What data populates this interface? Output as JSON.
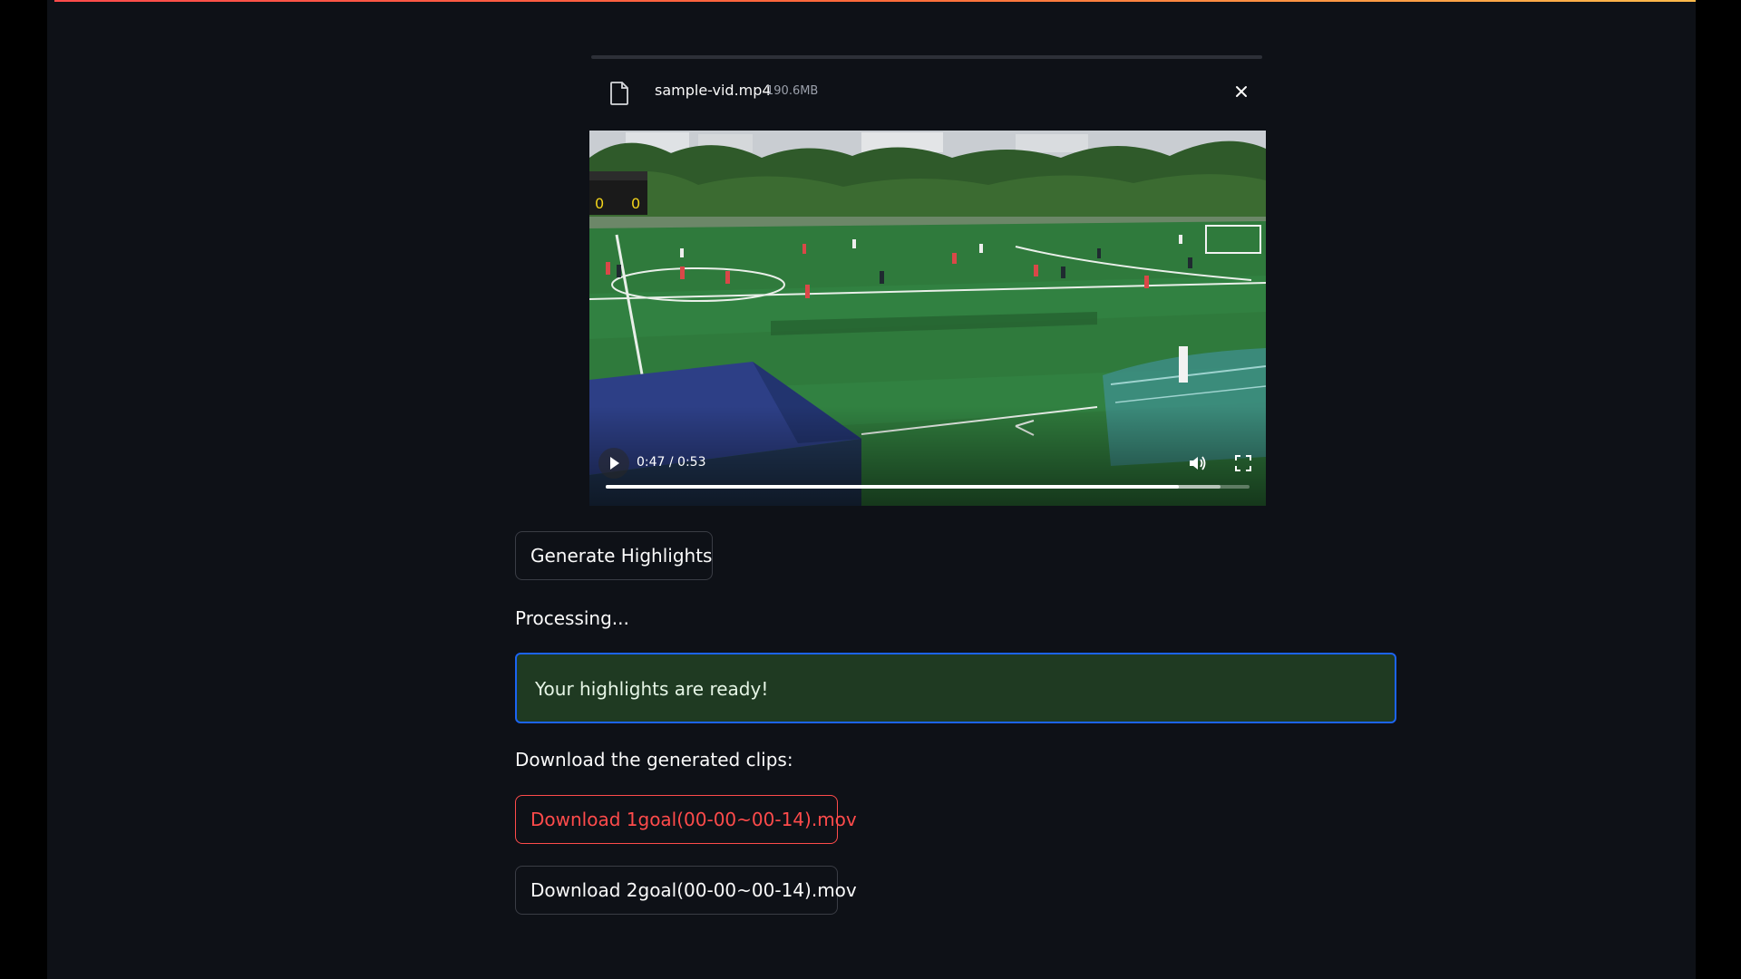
{
  "uploader": {
    "file_name": "sample-vid.mp4",
    "file_size": "190.6MB",
    "file_icon": "file-icon",
    "close_icon": "close-icon"
  },
  "video": {
    "time": "0:47 / 0:53",
    "played_fraction": 0.89,
    "buffered_fraction": 0.955,
    "play_icon": "play-icon",
    "volume_icon": "volume-icon",
    "fullscreen_icon": "fullscreen-icon",
    "more_icon": "more-vertical-icon",
    "scoreboard": {
      "home_score": "0",
      "away_score": "0"
    }
  },
  "actions": {
    "generate_label": "Generate Highlights",
    "processing_text": "Processing...",
    "success_text": "Your highlights are ready!",
    "download_label": "Download the generated clips:",
    "downloads": [
      "Download 1goal(00-00~00-14).mov",
      "Download 2goal(00-00~00-14).mov"
    ]
  },
  "colors": {
    "background": "#0e1117",
    "accent": "#ff4b4b",
    "success_bg": "#1f3a22",
    "focus_border": "#1c64f2",
    "field": "#2f7a3c"
  }
}
